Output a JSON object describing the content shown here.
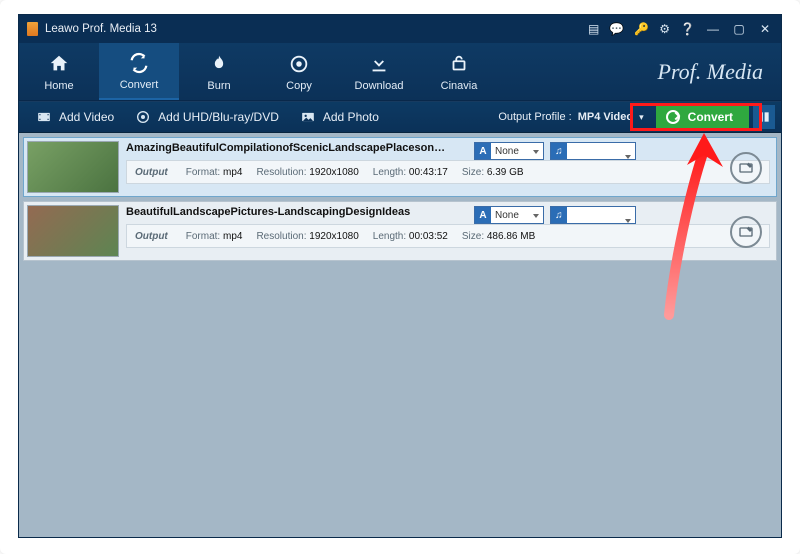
{
  "window": {
    "title": "Leawo Prof. Media 13"
  },
  "toolbar": {
    "home": "Home",
    "convert": "Convert",
    "burn": "Burn",
    "copy": "Copy",
    "download": "Download",
    "cinavia": "Cinavia",
    "brand": "Prof. Media"
  },
  "subbar": {
    "add_video": "Add Video",
    "add_disc": "Add UHD/Blu-ray/DVD",
    "add_photo": "Add Photo",
    "output_profile_label": "Output Profile :",
    "output_profile_value": "MP4 Video",
    "convert": "Convert"
  },
  "list": [
    {
      "title": "AmazingBeautifulCompilationofScenicLandscapePlacesonEarthScreenSav",
      "subtitle_sel": "None",
      "audio_sel": "",
      "output_label": "Output",
      "format_label": "Format:",
      "format": "mp4",
      "resolution_label": "Resolution:",
      "resolution": "1920x1080",
      "length_label": "Length:",
      "length": "00:43:17",
      "size_label": "Size:",
      "size": "6.39 GB"
    },
    {
      "title": "BeautifulLandscapePictures-LandscapingDesignIdeas",
      "subtitle_sel": "None",
      "audio_sel": "",
      "output_label": "Output",
      "format_label": "Format:",
      "format": "mp4",
      "resolution_label": "Resolution:",
      "resolution": "1920x1080",
      "length_label": "Length:",
      "length": "00:03:52",
      "size_label": "Size:",
      "size": "486.86 MB"
    }
  ]
}
